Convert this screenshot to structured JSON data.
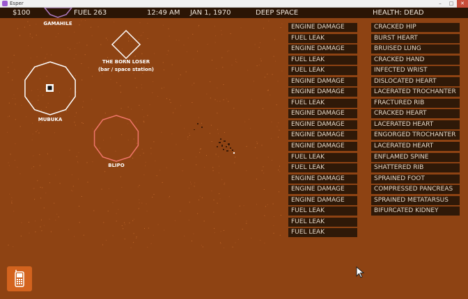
{
  "window": {
    "title": "Esper"
  },
  "hud": {
    "money": "$100",
    "fuel": "FUEL 263",
    "time": "12:49 AM",
    "date": "JAN 1, 1970",
    "location": "DEEP SPACE",
    "health": "HEALTH: DEAD"
  },
  "map": {
    "places": [
      {
        "name": "GAMAHILE"
      },
      {
        "name": "THE BORN LOSER",
        "subtitle": "(bar / space station)"
      },
      {
        "name": "MUBUKA"
      },
      {
        "name": "BLIPO"
      }
    ]
  },
  "ship_status": [
    "ENGINE DAMAGE",
    "FUEL LEAK",
    "ENGINE DAMAGE",
    "FUEL LEAK",
    "FUEL LEAK",
    "ENGINE DAMAGE",
    "ENGINE DAMAGE",
    "FUEL LEAK",
    "ENGINE DAMAGE",
    "ENGINE DAMAGE",
    "ENGINE DAMAGE",
    "ENGINE DAMAGE",
    "FUEL LEAK",
    "FUEL LEAK",
    "ENGINE DAMAGE",
    "ENGINE DAMAGE",
    "ENGINE DAMAGE",
    "FUEL LEAK",
    "FUEL LEAK",
    "FUEL LEAK"
  ],
  "injuries": [
    "CRACKED HIP",
    "BURST HEART",
    "BRUISED LUNG",
    "CRACKED HAND",
    "INFECTED WRIST",
    "DISLOCATED HEART",
    "LACERATED TROCHANTER",
    "FRACTURED RIB",
    "CRACKED HEART",
    "LACERATED HEART",
    "ENGORGED TROCHANTER",
    "LACERATED HEART",
    "ENFLAMED SPINE",
    "SHATTERED RIB",
    "SPRAINED FOOT",
    "COMPRESSED PANCREAS",
    "SPRAINED METATARSUS",
    "BIFURCATED KIDNEY"
  ],
  "colors": {
    "space": "#8e4313",
    "hud_bar": "#2b1505",
    "status_box": "#2f1908",
    "planet_white": "#ffffff",
    "planet_blipo": "#f0766a",
    "planet_gamahile": "#b07cc4",
    "phone_button": "#d3631e"
  },
  "icons": {
    "phone": "mobile-phone-icon",
    "player": "player-ship-icon"
  }
}
